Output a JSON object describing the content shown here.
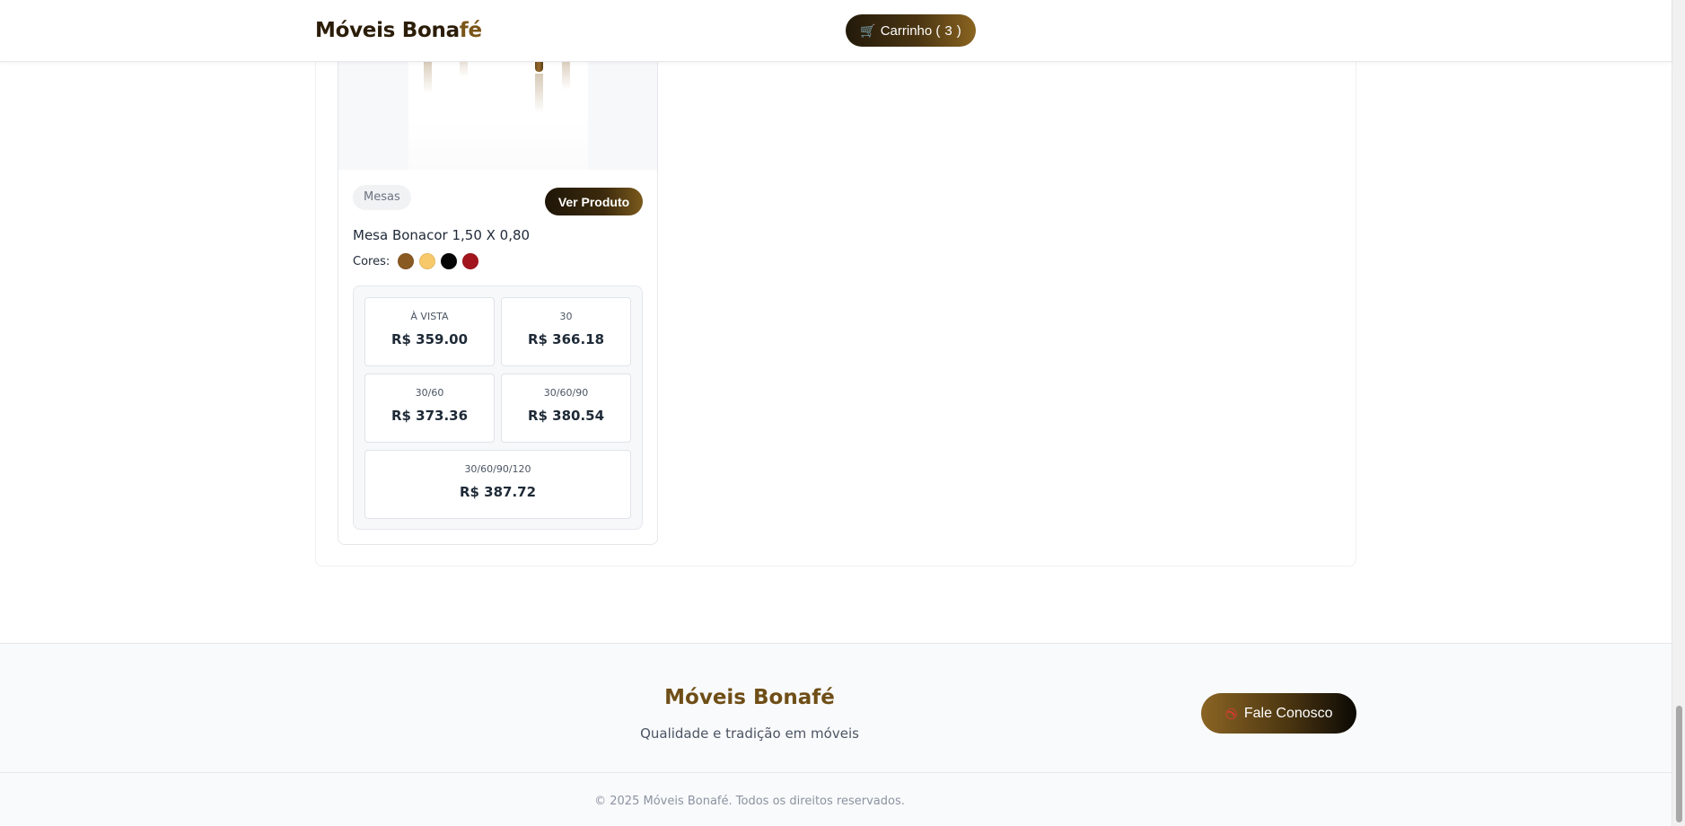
{
  "header": {
    "brand_part1": "Móveis Bona",
    "brand_part2": "fé",
    "cart": {
      "icon": "cart-icon",
      "label": "Carrinho (",
      "count": "3",
      "close": ")"
    }
  },
  "product": {
    "category": "Mesas",
    "view_button": "Ver Produto",
    "name": "Mesa Bonacor 1,50 X 0,80",
    "colors_label": "Cores:",
    "colors": [
      "#8a5a23",
      "#f8c96b",
      "#050505",
      "#a3151d"
    ],
    "prices": [
      {
        "label": "À VISTA",
        "value": "R$ 359.00"
      },
      {
        "label": "30",
        "value": "R$ 366.18"
      },
      {
        "label": "30/60",
        "value": "R$ 373.36"
      },
      {
        "label": "30/60/90",
        "value": "R$ 380.54"
      },
      {
        "label": "30/60/90/120",
        "value": "R$ 387.72"
      }
    ]
  },
  "footer": {
    "brand": "Móveis Bonafé",
    "tagline": "Qualidade e tradição em móveis",
    "contact_button": "Fale Conosco",
    "contact_icon": "phone-icon",
    "copyright": "© 2025 Móveis Bonafé. Todos os direitos reservados."
  }
}
